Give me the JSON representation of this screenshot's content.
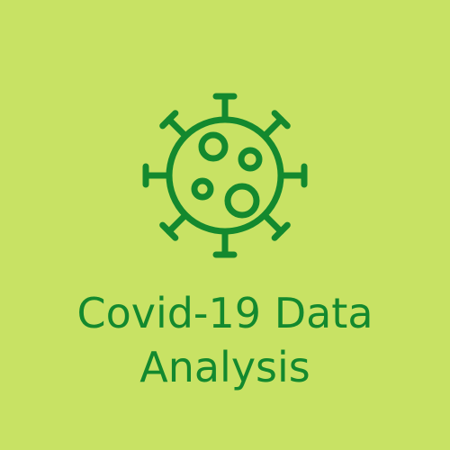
{
  "logo": {
    "icon": "virus-icon",
    "color": "#13892e",
    "background": "#c8e264"
  },
  "title": {
    "line1": "Covid-19 Data",
    "line2": "Analysis"
  }
}
